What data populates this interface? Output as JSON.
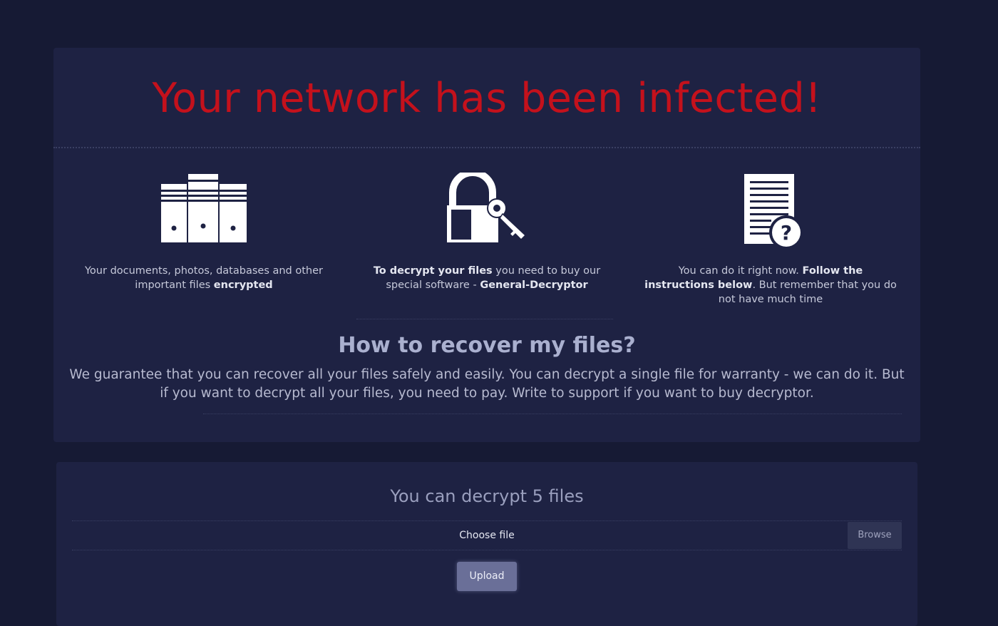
{
  "colors": {
    "background": "#161a34",
    "card": "#1e2243",
    "headline": "#c4111c",
    "accent_button": "#6a6f98"
  },
  "header": {
    "headline": "Your network has been infected!"
  },
  "features": [
    {
      "icon": "server-icon",
      "text_before": "Your documents, photos, databases and other important files ",
      "bold": "encrypted",
      "text_after": ""
    },
    {
      "icon": "padlock-key-icon",
      "bold_lead": "To decrypt your files",
      "text_mid": " you need to buy our special software - ",
      "bold": "General-Decryptor"
    },
    {
      "icon": "document-question-icon",
      "text_before": "You can do it right now. ",
      "bold": "Follow the instructions below",
      "text_after": ". But remember that you do not have much time"
    }
  ],
  "recover": {
    "title": "How to recover my files?",
    "text": "We guarantee that you can recover all your files safely and easily. You can decrypt a single file for warranty - we can do it. But if you want to decrypt all your files, you need to pay. Write to support if you want to buy decryptor."
  },
  "decrypt": {
    "title": "You can decrypt 5 files",
    "file_label": "Choose file",
    "browse_label": "Browse",
    "upload_label": "Upload"
  }
}
